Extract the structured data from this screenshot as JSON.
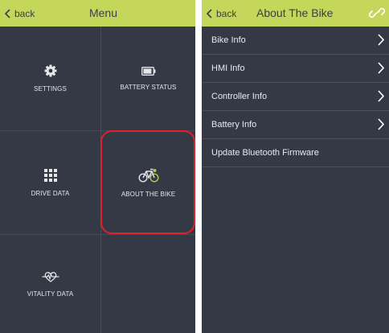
{
  "left_screen": {
    "back_label": "back",
    "title": "Menu",
    "tiles": [
      {
        "label": "SETTINGS",
        "icon": "gear-icon"
      },
      {
        "label": "BATTERY STATUS",
        "icon": "battery-icon"
      },
      {
        "label": "DRIVE DATA",
        "icon": "grid-icon"
      },
      {
        "label": "ABOUT THE BIKE",
        "icon": "bike-icon"
      },
      {
        "label": "VITALITY DATA",
        "icon": "heart-pulse-icon"
      }
    ]
  },
  "right_screen": {
    "back_label": "back",
    "title": "About The Bike",
    "items": [
      {
        "label": "Bike Info",
        "has_chevron": true
      },
      {
        "label": "HMI Info",
        "has_chevron": true
      },
      {
        "label": "Controller Info",
        "has_chevron": true
      },
      {
        "label": "Battery Info",
        "has_chevron": true
      },
      {
        "label": "Update Bluetooth Firmware",
        "has_chevron": false
      }
    ]
  },
  "colors": {
    "header": "#c4d75a",
    "background": "#353945",
    "accent_green": "#b3c94a",
    "highlight_red": "#e2202a"
  }
}
